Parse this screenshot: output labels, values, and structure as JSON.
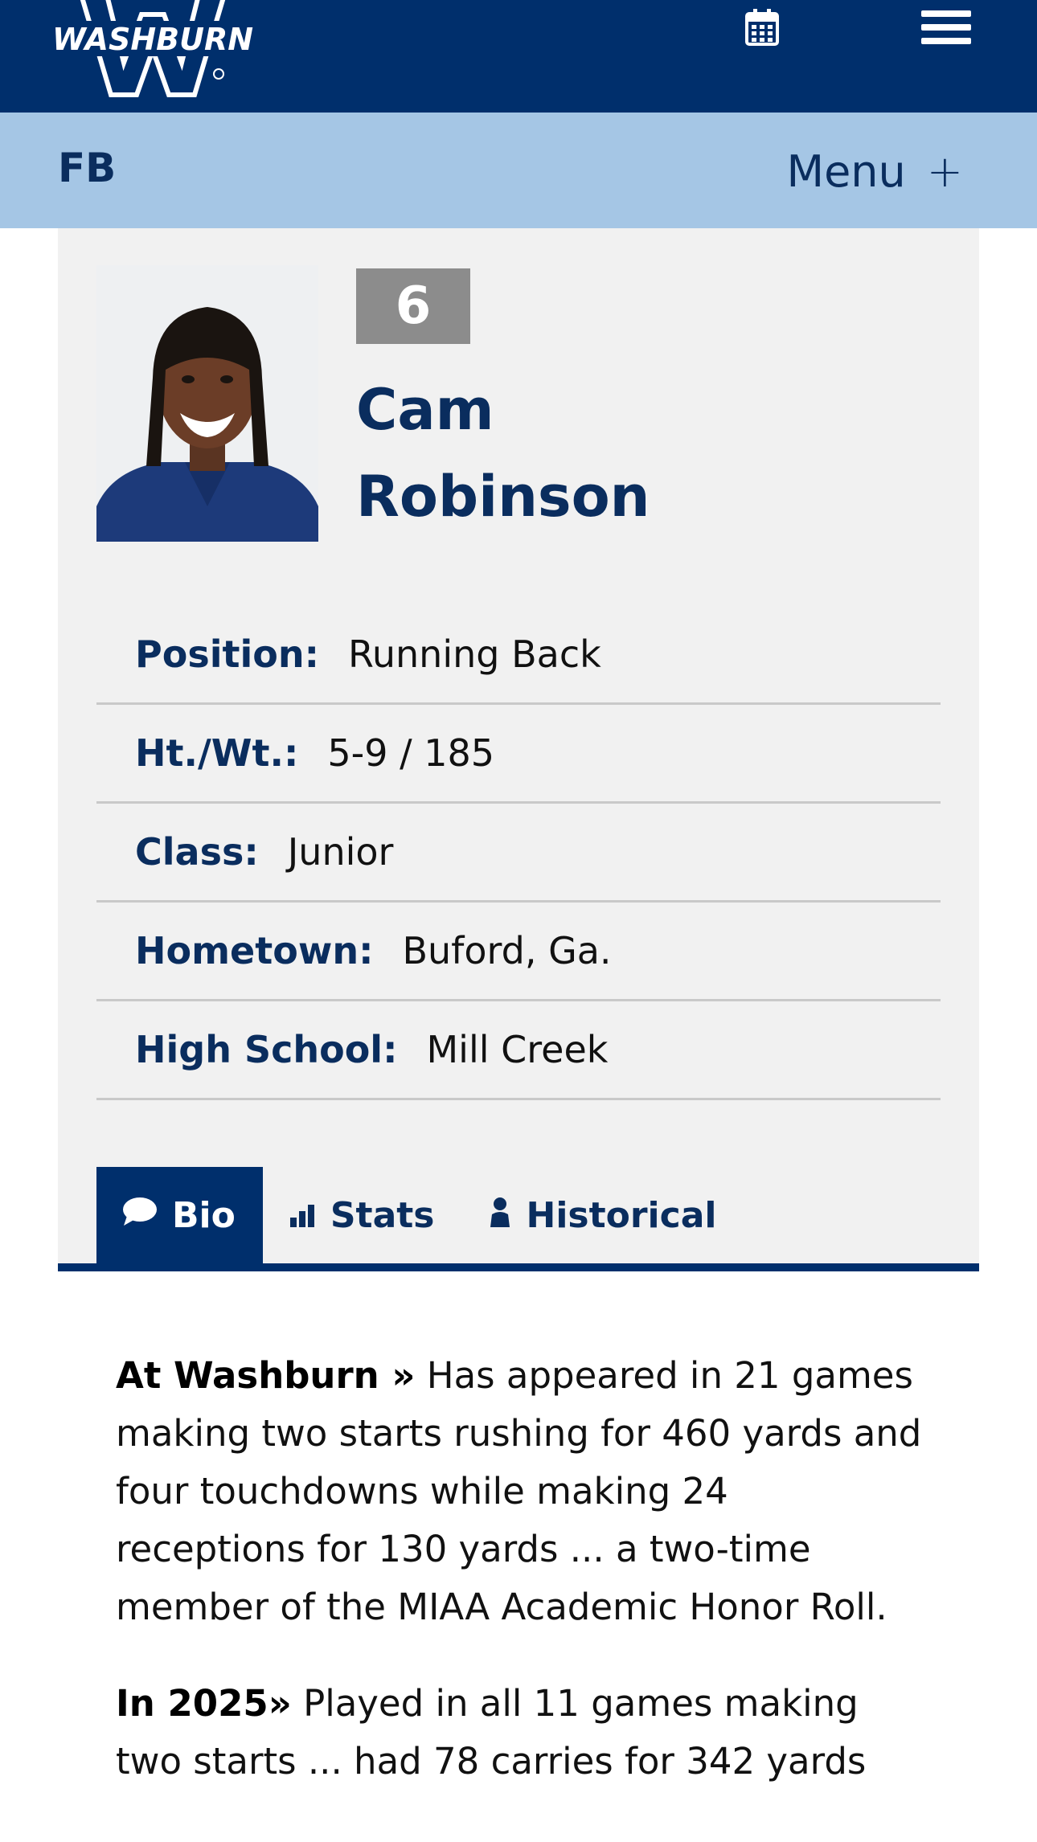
{
  "header": {
    "logo_text": "WASHBURN",
    "calendar_icon": "calendar-icon",
    "menu_icon": "hamburger-icon",
    "bg_color": "#002f6c"
  },
  "subnav": {
    "sport": "FB",
    "menu_label": "Menu",
    "menu_plus": "+",
    "bg_color": "#a5c6e5"
  },
  "player": {
    "number": "6",
    "first_name": "Cam",
    "last_name": "Robinson",
    "attributes": [
      {
        "label": "Position:",
        "value": "Running Back"
      },
      {
        "label": "Ht./Wt.:",
        "value": "5-9 / 185"
      },
      {
        "label": "Class:",
        "value": "Junior"
      },
      {
        "label": "Hometown:",
        "value": "Buford, Ga."
      },
      {
        "label": "High School:",
        "value": "Mill Creek"
      }
    ]
  },
  "tabs": [
    {
      "label": "Bio",
      "icon": "comment-icon",
      "active": true
    },
    {
      "label": "Stats",
      "icon": "bar-chart-icon",
      "active": false
    },
    {
      "label": "Historical",
      "icon": "person-icon",
      "active": false
    }
  ],
  "bio": [
    {
      "lead": "At Washburn »",
      "text": " Has appeared in 21 games making two starts rushing for 460 yards and four touchdowns while making 24 receptions for 130 yards ... a two-time member of the MIAA Academic Honor Roll."
    },
    {
      "lead": "In 2025»",
      "text": " Played in all 11 games making two starts ... had 78 carries for 342 yards"
    }
  ],
  "colors": {
    "navy": "#002f6c",
    "text_navy": "#0a2d5e",
    "light_blue": "#a5c6e5",
    "card_bg": "#f1f1f1",
    "jersey_bg": "#8c8c8c"
  }
}
